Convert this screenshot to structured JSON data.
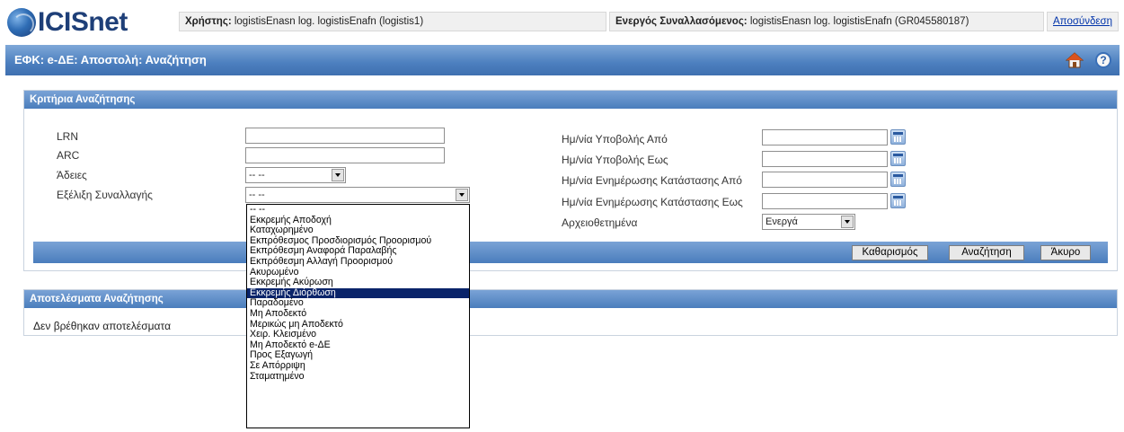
{
  "header": {
    "logo_text": "ICISnet",
    "user_label": "Χρήστης:",
    "user_value": "logistisEnasn log. logistisEnafn (logistis1)",
    "trader_label": "Ενεργός Συναλλασόμενος:",
    "trader_value": "logistisEnasn log. logistisEnafn (GR045580187)",
    "logout_label": "Αποσύνδεση"
  },
  "titlebar": {
    "title": "ΕΦΚ: e-ΔΕ: Αποστολή: Αναζήτηση"
  },
  "criteria": {
    "heading": "Κριτήρια Αναζήτησης",
    "lrn_label": "LRN",
    "arc_label": "ARC",
    "permits_label": "Άδειες",
    "permits_value": "-- --",
    "progress_label": "Εξέλιξη Συναλλαγής",
    "progress_value": "-- --",
    "submit_from_label": "Ημ/νία Υποβολής Από",
    "submit_to_label": "Ημ/νία Υποβολής Εως",
    "update_from_label": "Ημ/νία Ενημέρωσης Κατάστασης Από",
    "update_to_label": "Ημ/νία Ενημέρωσης Κατάστασης Εως",
    "archived_label": "Αρχειοθετημένα",
    "archived_value": "Ενεργά",
    "clear_button": "Καθαρισμός",
    "search_button": "Αναζήτηση",
    "cancel_button": "Άκυρο"
  },
  "results": {
    "heading": "Αποτελέσματα Αναζήτησης",
    "message": "Δεν βρέθηκαν αποτελέσματα"
  },
  "dropdown": {
    "highlighted_index": 9,
    "options": [
      "-- --",
      "Εκκρεμής Αποδοχή",
      "Καταχωρημένο",
      "Εκπρόθεσμος Προσδιορισμός Προορισμού",
      "Εκπρόθεσμη Αναφορά Παραλαβής",
      "Εκπρόθεσμη Αλλαγή Προορισμού",
      "Ακυρωμένο",
      "Εκκρεμής Ακύρωση",
      "Εκκρεμής Διόρθωση",
      "Παραδομένο",
      "Μη Αποδεκτό",
      "Μερικώς μη Αποδεκτό",
      "Χειρ. Κλεισμένο",
      "Μη Αποδεκτό e-ΔΕ",
      "Προς Εξαγωγή",
      "Σε Απόρριψη",
      "Σταματημένο"
    ]
  },
  "colors": {
    "title_bar": "#4c7fbf",
    "highlight": "#0a246a",
    "brand": "#1e3f78"
  }
}
